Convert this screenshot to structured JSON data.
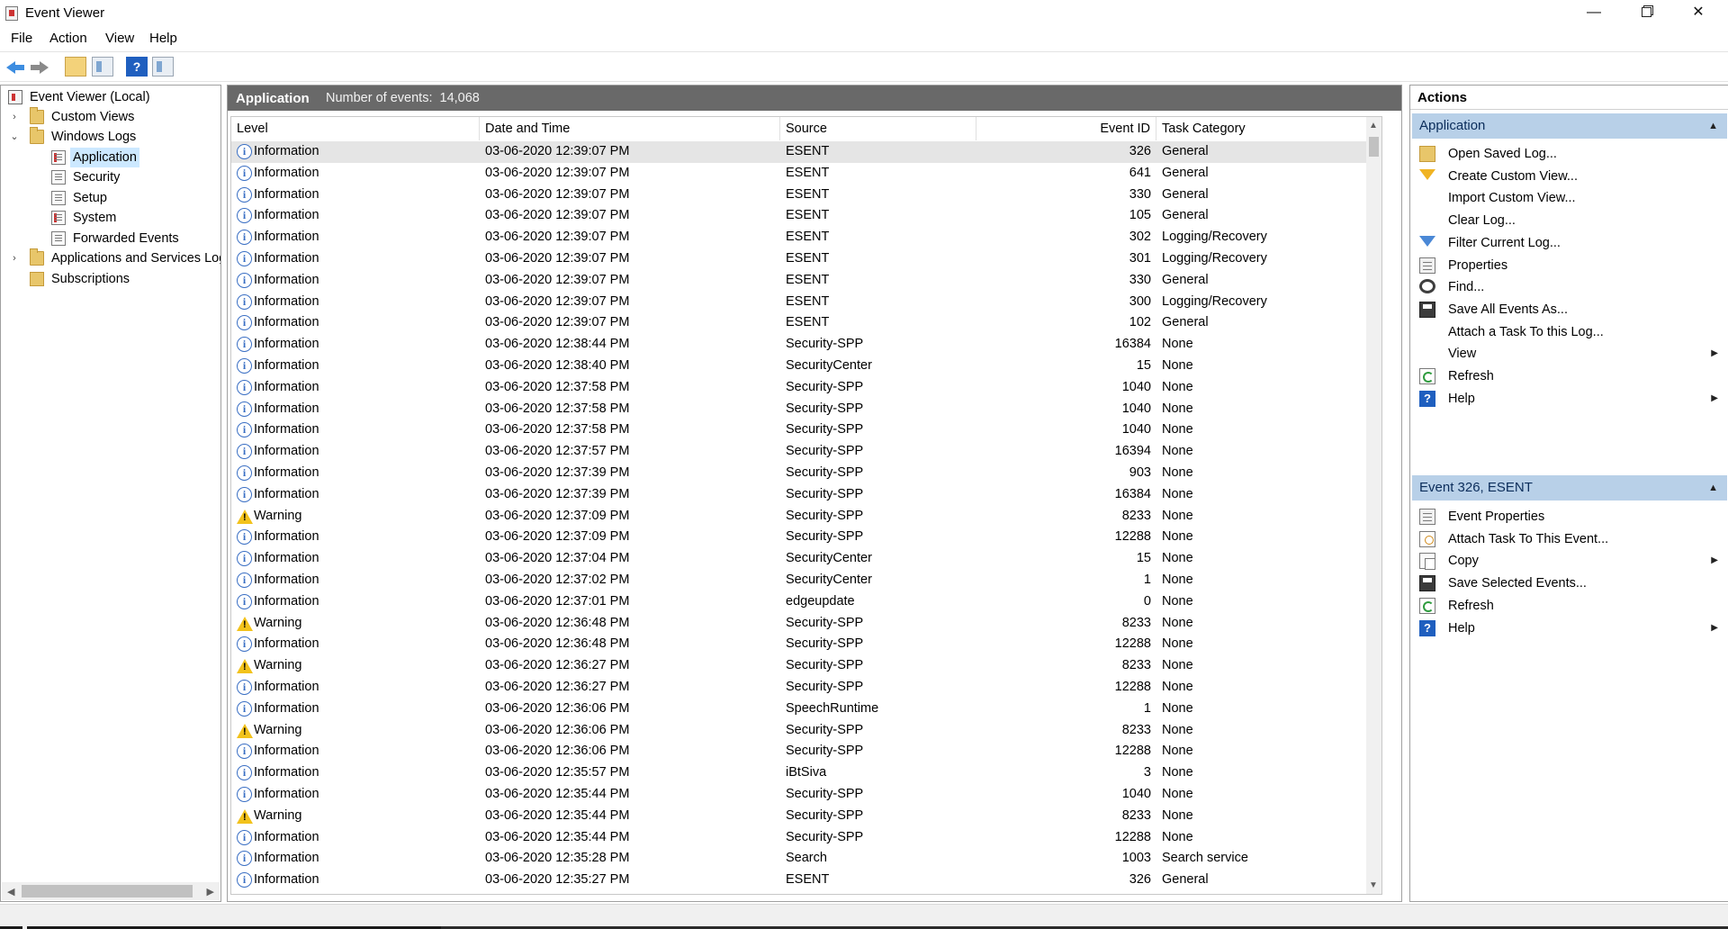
{
  "window": {
    "title": "Event Viewer",
    "minimize_symbol": "—",
    "close_symbol": "✕"
  },
  "menu": {
    "file": "File",
    "action": "Action",
    "view": "View",
    "help": "Help"
  },
  "toolbar": {
    "icons": [
      "back-icon",
      "forward-icon",
      "up-folder-icon",
      "show-hide-tree-icon",
      "help-icon",
      "show-hide-action-pane-icon"
    ],
    "help_glyph": "?"
  },
  "tree": {
    "root": "Event Viewer (Local)",
    "custom_views": "Custom Views",
    "windows_logs": "Windows Logs",
    "application": "Application",
    "security": "Security",
    "setup": "Setup",
    "system": "System",
    "forwarded_events": "Forwarded Events",
    "apps_services": "Applications and Services Logs",
    "subscriptions": "Subscriptions",
    "collapsed_glyph": "›",
    "expanded_glyph": "⌄"
  },
  "center": {
    "log_name": "Application",
    "count_label": "Number of events:",
    "count_value": "14,068",
    "columns": {
      "level": "Level",
      "datetime": "Date and Time",
      "source": "Source",
      "event_id": "Event ID",
      "task_category": "Task Category"
    },
    "info_glyph": "i",
    "rows": [
      {
        "level": "Information",
        "datetime": "03-06-2020 12:39:07 PM",
        "source": "ESENT",
        "event_id": "326",
        "category": "General"
      },
      {
        "level": "Information",
        "datetime": "03-06-2020 12:39:07 PM",
        "source": "ESENT",
        "event_id": "641",
        "category": "General"
      },
      {
        "level": "Information",
        "datetime": "03-06-2020 12:39:07 PM",
        "source": "ESENT",
        "event_id": "330",
        "category": "General"
      },
      {
        "level": "Information",
        "datetime": "03-06-2020 12:39:07 PM",
        "source": "ESENT",
        "event_id": "105",
        "category": "General"
      },
      {
        "level": "Information",
        "datetime": "03-06-2020 12:39:07 PM",
        "source": "ESENT",
        "event_id": "302",
        "category": "Logging/Recovery"
      },
      {
        "level": "Information",
        "datetime": "03-06-2020 12:39:07 PM",
        "source": "ESENT",
        "event_id": "301",
        "category": "Logging/Recovery"
      },
      {
        "level": "Information",
        "datetime": "03-06-2020 12:39:07 PM",
        "source": "ESENT",
        "event_id": "330",
        "category": "General"
      },
      {
        "level": "Information",
        "datetime": "03-06-2020 12:39:07 PM",
        "source": "ESENT",
        "event_id": "300",
        "category": "Logging/Recovery"
      },
      {
        "level": "Information",
        "datetime": "03-06-2020 12:39:07 PM",
        "source": "ESENT",
        "event_id": "102",
        "category": "General"
      },
      {
        "level": "Information",
        "datetime": "03-06-2020 12:38:44 PM",
        "source": "Security-SPP",
        "event_id": "16384",
        "category": "None"
      },
      {
        "level": "Information",
        "datetime": "03-06-2020 12:38:40 PM",
        "source": "SecurityCenter",
        "event_id": "15",
        "category": "None"
      },
      {
        "level": "Information",
        "datetime": "03-06-2020 12:37:58 PM",
        "source": "Security-SPP",
        "event_id": "1040",
        "category": "None"
      },
      {
        "level": "Information",
        "datetime": "03-06-2020 12:37:58 PM",
        "source": "Security-SPP",
        "event_id": "1040",
        "category": "None"
      },
      {
        "level": "Information",
        "datetime": "03-06-2020 12:37:58 PM",
        "source": "Security-SPP",
        "event_id": "1040",
        "category": "None"
      },
      {
        "level": "Information",
        "datetime": "03-06-2020 12:37:57 PM",
        "source": "Security-SPP",
        "event_id": "16394",
        "category": "None"
      },
      {
        "level": "Information",
        "datetime": "03-06-2020 12:37:39 PM",
        "source": "Security-SPP",
        "event_id": "903",
        "category": "None"
      },
      {
        "level": "Information",
        "datetime": "03-06-2020 12:37:39 PM",
        "source": "Security-SPP",
        "event_id": "16384",
        "category": "None"
      },
      {
        "level": "Warning",
        "datetime": "03-06-2020 12:37:09 PM",
        "source": "Security-SPP",
        "event_id": "8233",
        "category": "None"
      },
      {
        "level": "Information",
        "datetime": "03-06-2020 12:37:09 PM",
        "source": "Security-SPP",
        "event_id": "12288",
        "category": "None"
      },
      {
        "level": "Information",
        "datetime": "03-06-2020 12:37:04 PM",
        "source": "SecurityCenter",
        "event_id": "15",
        "category": "None"
      },
      {
        "level": "Information",
        "datetime": "03-06-2020 12:37:02 PM",
        "source": "SecurityCenter",
        "event_id": "1",
        "category": "None"
      },
      {
        "level": "Information",
        "datetime": "03-06-2020 12:37:01 PM",
        "source": "edgeupdate",
        "event_id": "0",
        "category": "None"
      },
      {
        "level": "Warning",
        "datetime": "03-06-2020 12:36:48 PM",
        "source": "Security-SPP",
        "event_id": "8233",
        "category": "None"
      },
      {
        "level": "Information",
        "datetime": "03-06-2020 12:36:48 PM",
        "source": "Security-SPP",
        "event_id": "12288",
        "category": "None"
      },
      {
        "level": "Warning",
        "datetime": "03-06-2020 12:36:27 PM",
        "source": "Security-SPP",
        "event_id": "8233",
        "category": "None"
      },
      {
        "level": "Information",
        "datetime": "03-06-2020 12:36:27 PM",
        "source": "Security-SPP",
        "event_id": "12288",
        "category": "None"
      },
      {
        "level": "Information",
        "datetime": "03-06-2020 12:36:06 PM",
        "source": "SpeechRuntime",
        "event_id": "1",
        "category": "None"
      },
      {
        "level": "Warning",
        "datetime": "03-06-2020 12:36:06 PM",
        "source": "Security-SPP",
        "event_id": "8233",
        "category": "None"
      },
      {
        "level": "Information",
        "datetime": "03-06-2020 12:36:06 PM",
        "source": "Security-SPP",
        "event_id": "12288",
        "category": "None"
      },
      {
        "level": "Information",
        "datetime": "03-06-2020 12:35:57 PM",
        "source": "iBtSiva",
        "event_id": "3",
        "category": "None"
      },
      {
        "level": "Information",
        "datetime": "03-06-2020 12:35:44 PM",
        "source": "Security-SPP",
        "event_id": "1040",
        "category": "None"
      },
      {
        "level": "Warning",
        "datetime": "03-06-2020 12:35:44 PM",
        "source": "Security-SPP",
        "event_id": "8233",
        "category": "None"
      },
      {
        "level": "Information",
        "datetime": "03-06-2020 12:35:44 PM",
        "source": "Security-SPP",
        "event_id": "12288",
        "category": "None"
      },
      {
        "level": "Information",
        "datetime": "03-06-2020 12:35:28 PM",
        "source": "Search",
        "event_id": "1003",
        "category": "Search service"
      },
      {
        "level": "Information",
        "datetime": "03-06-2020 12:35:27 PM",
        "source": "ESENT",
        "event_id": "326",
        "category": "General"
      }
    ]
  },
  "actions": {
    "title": "Actions",
    "section1": {
      "title": "Application",
      "items": [
        {
          "label": "Open Saved Log...",
          "icon": "open-folder-icon"
        },
        {
          "label": "Create Custom View...",
          "icon": "filter-icon"
        },
        {
          "label": "Import Custom View...",
          "icon": ""
        },
        {
          "label": "Clear Log...",
          "icon": ""
        },
        {
          "label": "Filter Current Log...",
          "icon": "filter-icon"
        },
        {
          "label": "Properties",
          "icon": "properties-icon"
        },
        {
          "label": "Find...",
          "icon": "binoculars-icon"
        },
        {
          "label": "Save All Events As...",
          "icon": "save-icon"
        },
        {
          "label": "Attach a Task To this Log...",
          "icon": ""
        },
        {
          "label": "View",
          "icon": ""
        },
        {
          "label": "Refresh",
          "icon": "refresh-icon"
        },
        {
          "label": "Help",
          "icon": "help-icon"
        }
      ]
    },
    "section2": {
      "title": "Event 326, ESENT",
      "items": [
        {
          "label": "Event Properties",
          "icon": "properties-icon"
        },
        {
          "label": "Attach Task To This Event...",
          "icon": "task-icon"
        },
        {
          "label": "Copy",
          "icon": "copy-icon"
        },
        {
          "label": "Save Selected Events...",
          "icon": "save-icon"
        },
        {
          "label": "Refresh",
          "icon": "refresh-icon"
        },
        {
          "label": "Help",
          "icon": "help-icon"
        }
      ]
    },
    "collapse_glyph": "▲",
    "submenu_glyph": "▶",
    "help_glyph": "?"
  }
}
